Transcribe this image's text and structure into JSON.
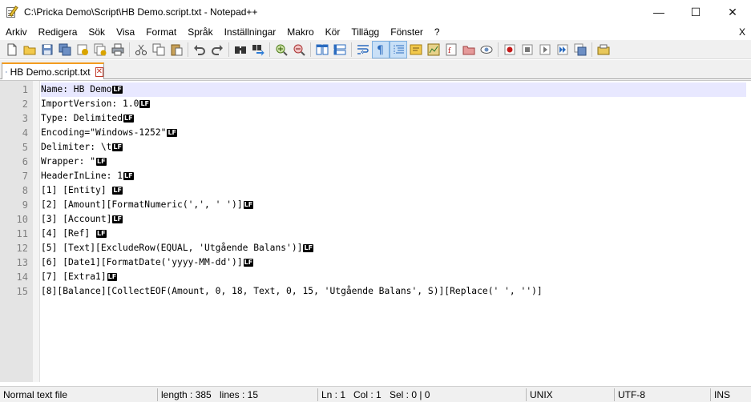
{
  "window": {
    "title": "C:\\Pricka Demo\\Script\\HB Demo.script.txt - Notepad++",
    "minimize": "—",
    "maximize": "☐",
    "close": "✕"
  },
  "menu": {
    "items": [
      "Arkiv",
      "Redigera",
      "Sök",
      "Visa",
      "Format",
      "Språk",
      "Inställningar",
      "Makro",
      "Kör",
      "Tillägg",
      "Fönster",
      "?"
    ],
    "close_label": "X"
  },
  "tab": {
    "label": "HB Demo.script.txt",
    "close_label": "✕"
  },
  "editor": {
    "eol_marker": "LF",
    "lines": [
      {
        "num": "1",
        "text": "Name: HB Demo",
        "eol": true
      },
      {
        "num": "2",
        "text": "ImportVersion: 1.0",
        "eol": true
      },
      {
        "num": "3",
        "text": "Type: Delimited",
        "eol": true
      },
      {
        "num": "4",
        "text": "Encoding=\"Windows-1252\"",
        "eol": true
      },
      {
        "num": "5",
        "text": "Delimiter: \\t",
        "eol": true
      },
      {
        "num": "6",
        "text": "Wrapper: \"",
        "eol": true
      },
      {
        "num": "7",
        "text": "HeaderInLine: 1",
        "eol": true
      },
      {
        "num": "8",
        "text": "[1] [Entity] ",
        "eol": true
      },
      {
        "num": "9",
        "text": "[2] [Amount][FormatNumeric(',', ' ')]",
        "eol": true
      },
      {
        "num": "10",
        "text": "[3] [Account]",
        "eol": true
      },
      {
        "num": "11",
        "text": "[4] [Ref] ",
        "eol": true
      },
      {
        "num": "12",
        "text": "[5] [Text][ExcludeRow(EQUAL, 'Utgående Balans')]",
        "eol": true
      },
      {
        "num": "13",
        "text": "[6] [Date1][FormatDate('yyyy-MM-dd')]",
        "eol": true
      },
      {
        "num": "14",
        "text": "[7] [Extra1]",
        "eol": true
      },
      {
        "num": "15",
        "text": "[8][Balance][CollectEOF(Amount, 0, 18, Text, 0, 15, 'Utgående Balans', S)][Replace(' ', '')]",
        "eol": false
      }
    ]
  },
  "status": {
    "file_type": "Normal text file",
    "length": "length : 385",
    "lines": "lines : 15",
    "ln": "Ln : 1",
    "col": "Col : 1",
    "sel": "Sel : 0 | 0",
    "eol_format": "UNIX",
    "encoding": "UTF-8",
    "insert_mode": "INS"
  },
  "toolbar_icons": [
    "new-file-icon",
    "open-file-icon",
    "save-icon",
    "save-all-icon",
    "close-icon",
    "close-all-icon",
    "print-icon",
    "cut-icon",
    "copy-icon",
    "paste-icon",
    "undo-icon",
    "redo-icon",
    "find-icon",
    "replace-icon",
    "zoom-in-icon",
    "zoom-out-icon",
    "sync-vertical-icon",
    "sync-horizontal-icon",
    "word-wrap-icon",
    "show-all-characters-icon",
    "indent-guide-icon",
    "user-language-icon",
    "document-map-icon",
    "function-list-icon",
    "folder-workspace-icon",
    "monitoring-icon",
    "record-macro-icon",
    "stop-record-icon",
    "play-macro-icon",
    "run-macro-multiple-icon",
    "save-macro-icon",
    "plugin-icon"
  ],
  "colors": {
    "tab_accent": "#f39c1f",
    "current_line": "#e8e8ff",
    "gutter": "#e4e4e4",
    "line_number": "#808080"
  }
}
